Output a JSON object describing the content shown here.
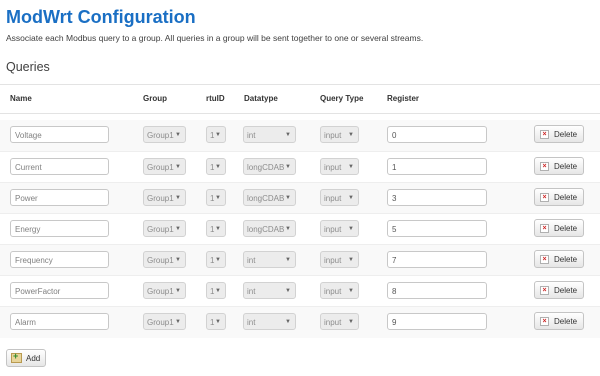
{
  "page": {
    "title": "ModWrt Configuration",
    "description": "Associate each Modbus query to a group. All queries in a group will be sent together to one or several streams.",
    "section": "Queries"
  },
  "table": {
    "headers": {
      "name": "Name",
      "group": "Group",
      "rtuid": "rtuID",
      "datatype": "Datatype",
      "query_type": "Query Type",
      "register": "Register"
    },
    "rows": [
      {
        "name": "Voltage",
        "group": "Group1",
        "rtuid": "1",
        "datatype": "int",
        "query_type": "input",
        "register": "0"
      },
      {
        "name": "Current",
        "group": "Group1",
        "rtuid": "1",
        "datatype": "longCDAB",
        "query_type": "input",
        "register": "1"
      },
      {
        "name": "Power",
        "group": "Group1",
        "rtuid": "1",
        "datatype": "longCDAB",
        "query_type": "input",
        "register": "3"
      },
      {
        "name": "Energy",
        "group": "Group1",
        "rtuid": "1",
        "datatype": "longCDAB",
        "query_type": "input",
        "register": "5"
      },
      {
        "name": "Frequency",
        "group": "Group1",
        "rtuid": "1",
        "datatype": "int",
        "query_type": "input",
        "register": "7"
      },
      {
        "name": "PowerFactor",
        "group": "Group1",
        "rtuid": "1",
        "datatype": "int",
        "query_type": "input",
        "register": "8"
      },
      {
        "name": "Alarm",
        "group": "Group1",
        "rtuid": "1",
        "datatype": "int",
        "query_type": "input",
        "register": "9"
      }
    ],
    "delete_label": "Delete"
  },
  "actions": {
    "add_label": "Add"
  }
}
